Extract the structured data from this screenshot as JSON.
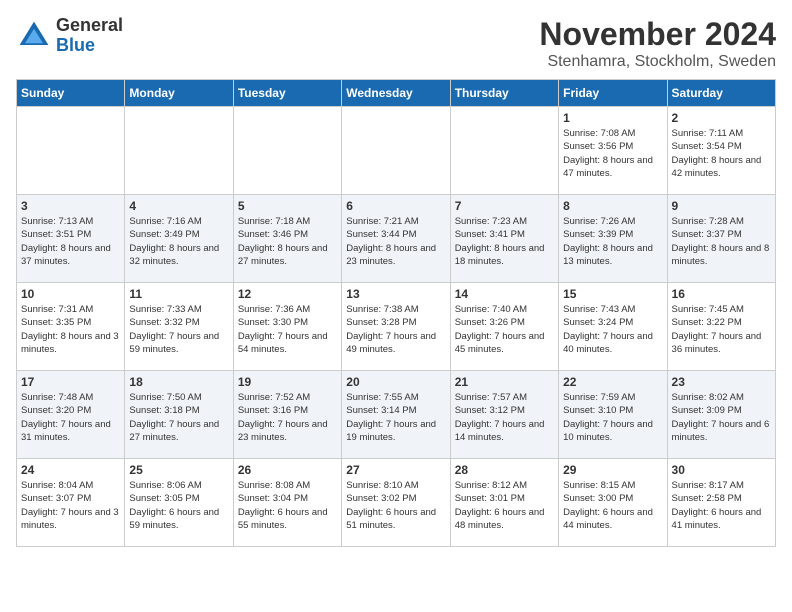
{
  "logo": {
    "general": "General",
    "blue": "Blue"
  },
  "header": {
    "month": "November 2024",
    "location": "Stenhamra, Stockholm, Sweden"
  },
  "days_of_week": [
    "Sunday",
    "Monday",
    "Tuesday",
    "Wednesday",
    "Thursday",
    "Friday",
    "Saturday"
  ],
  "weeks": [
    [
      {
        "day": "",
        "info": ""
      },
      {
        "day": "",
        "info": ""
      },
      {
        "day": "",
        "info": ""
      },
      {
        "day": "",
        "info": ""
      },
      {
        "day": "",
        "info": ""
      },
      {
        "day": "1",
        "info": "Sunrise: 7:08 AM\nSunset: 3:56 PM\nDaylight: 8 hours and 47 minutes."
      },
      {
        "day": "2",
        "info": "Sunrise: 7:11 AM\nSunset: 3:54 PM\nDaylight: 8 hours and 42 minutes."
      }
    ],
    [
      {
        "day": "3",
        "info": "Sunrise: 7:13 AM\nSunset: 3:51 PM\nDaylight: 8 hours and 37 minutes."
      },
      {
        "day": "4",
        "info": "Sunrise: 7:16 AM\nSunset: 3:49 PM\nDaylight: 8 hours and 32 minutes."
      },
      {
        "day": "5",
        "info": "Sunrise: 7:18 AM\nSunset: 3:46 PM\nDaylight: 8 hours and 27 minutes."
      },
      {
        "day": "6",
        "info": "Sunrise: 7:21 AM\nSunset: 3:44 PM\nDaylight: 8 hours and 23 minutes."
      },
      {
        "day": "7",
        "info": "Sunrise: 7:23 AM\nSunset: 3:41 PM\nDaylight: 8 hours and 18 minutes."
      },
      {
        "day": "8",
        "info": "Sunrise: 7:26 AM\nSunset: 3:39 PM\nDaylight: 8 hours and 13 minutes."
      },
      {
        "day": "9",
        "info": "Sunrise: 7:28 AM\nSunset: 3:37 PM\nDaylight: 8 hours and 8 minutes."
      }
    ],
    [
      {
        "day": "10",
        "info": "Sunrise: 7:31 AM\nSunset: 3:35 PM\nDaylight: 8 hours and 3 minutes."
      },
      {
        "day": "11",
        "info": "Sunrise: 7:33 AM\nSunset: 3:32 PM\nDaylight: 7 hours and 59 minutes."
      },
      {
        "day": "12",
        "info": "Sunrise: 7:36 AM\nSunset: 3:30 PM\nDaylight: 7 hours and 54 minutes."
      },
      {
        "day": "13",
        "info": "Sunrise: 7:38 AM\nSunset: 3:28 PM\nDaylight: 7 hours and 49 minutes."
      },
      {
        "day": "14",
        "info": "Sunrise: 7:40 AM\nSunset: 3:26 PM\nDaylight: 7 hours and 45 minutes."
      },
      {
        "day": "15",
        "info": "Sunrise: 7:43 AM\nSunset: 3:24 PM\nDaylight: 7 hours and 40 minutes."
      },
      {
        "day": "16",
        "info": "Sunrise: 7:45 AM\nSunset: 3:22 PM\nDaylight: 7 hours and 36 minutes."
      }
    ],
    [
      {
        "day": "17",
        "info": "Sunrise: 7:48 AM\nSunset: 3:20 PM\nDaylight: 7 hours and 31 minutes."
      },
      {
        "day": "18",
        "info": "Sunrise: 7:50 AM\nSunset: 3:18 PM\nDaylight: 7 hours and 27 minutes."
      },
      {
        "day": "19",
        "info": "Sunrise: 7:52 AM\nSunset: 3:16 PM\nDaylight: 7 hours and 23 minutes."
      },
      {
        "day": "20",
        "info": "Sunrise: 7:55 AM\nSunset: 3:14 PM\nDaylight: 7 hours and 19 minutes."
      },
      {
        "day": "21",
        "info": "Sunrise: 7:57 AM\nSunset: 3:12 PM\nDaylight: 7 hours and 14 minutes."
      },
      {
        "day": "22",
        "info": "Sunrise: 7:59 AM\nSunset: 3:10 PM\nDaylight: 7 hours and 10 minutes."
      },
      {
        "day": "23",
        "info": "Sunrise: 8:02 AM\nSunset: 3:09 PM\nDaylight: 7 hours and 6 minutes."
      }
    ],
    [
      {
        "day": "24",
        "info": "Sunrise: 8:04 AM\nSunset: 3:07 PM\nDaylight: 7 hours and 3 minutes."
      },
      {
        "day": "25",
        "info": "Sunrise: 8:06 AM\nSunset: 3:05 PM\nDaylight: 6 hours and 59 minutes."
      },
      {
        "day": "26",
        "info": "Sunrise: 8:08 AM\nSunset: 3:04 PM\nDaylight: 6 hours and 55 minutes."
      },
      {
        "day": "27",
        "info": "Sunrise: 8:10 AM\nSunset: 3:02 PM\nDaylight: 6 hours and 51 minutes."
      },
      {
        "day": "28",
        "info": "Sunrise: 8:12 AM\nSunset: 3:01 PM\nDaylight: 6 hours and 48 minutes."
      },
      {
        "day": "29",
        "info": "Sunrise: 8:15 AM\nSunset: 3:00 PM\nDaylight: 6 hours and 44 minutes."
      },
      {
        "day": "30",
        "info": "Sunrise: 8:17 AM\nSunset: 2:58 PM\nDaylight: 6 hours and 41 minutes."
      }
    ]
  ]
}
